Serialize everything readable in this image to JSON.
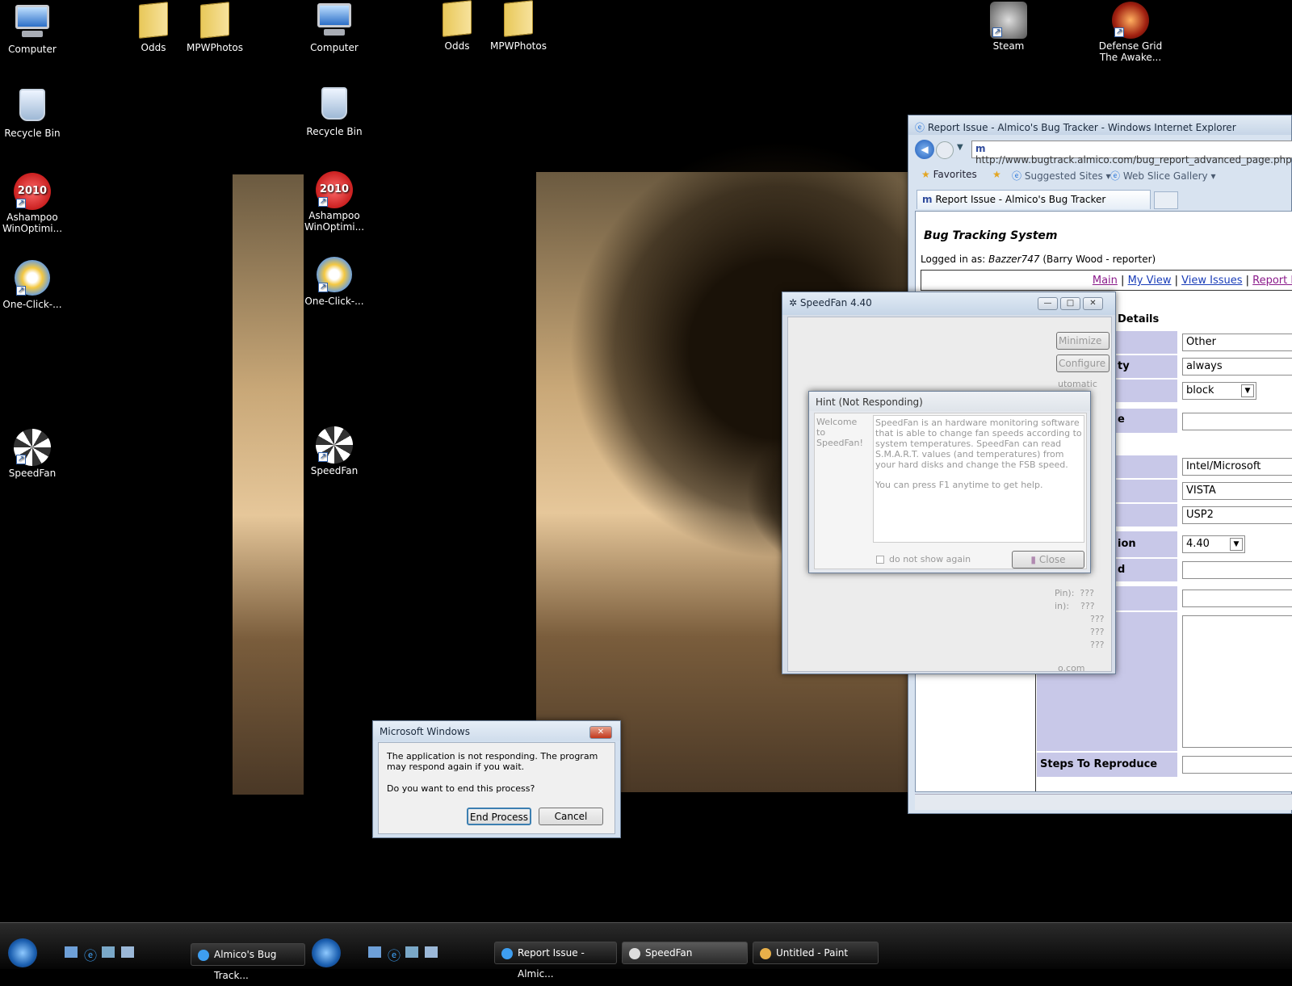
{
  "desktop": {
    "icons_left": [
      {
        "label": "Computer",
        "type": "monitor"
      },
      {
        "label": "Odds",
        "type": "folder"
      },
      {
        "label": "MPWPhotos",
        "type": "folder"
      },
      {
        "label": "Recycle Bin",
        "type": "bin"
      },
      {
        "label": "Ashampoo WinOptimi...",
        "type": "red"
      },
      {
        "label": "One-Click-...",
        "type": "gears"
      },
      {
        "label": "SpeedFan",
        "type": "fan"
      }
    ],
    "icons_mid": [
      {
        "label": "Computer"
      },
      {
        "label": "Odds"
      },
      {
        "label": "MPWPhotos"
      },
      {
        "label": "Recycle Bin"
      },
      {
        "label": "Ashampoo WinOptimi..."
      },
      {
        "label": "One-Click-..."
      },
      {
        "label": "SpeedFan"
      }
    ],
    "icons_right": [
      {
        "label": "Steam"
      },
      {
        "label": "Defense Grid The Awake..."
      }
    ],
    "ashampoo_badge": "2010"
  },
  "ie": {
    "title": "Report Issue - Almico's Bug Tracker - Windows Internet Explorer",
    "url": "http://www.bugtrack.almico.com/bug_report_advanced_page.php",
    "favorites": "Favorites",
    "suggested": "Suggested Sites ▾",
    "webslice": "Web Slice Gallery ▾",
    "tab": "Report Issue - Almico's Bug Tracker",
    "page": {
      "heading": "Bug Tracking System",
      "logged_prefix": "Logged in as: ",
      "user": "Bazzer747",
      "user_detail": " (Barry Wood - reporter)",
      "nav": [
        "Main",
        "My View",
        "View Issues",
        "Report Is"
      ],
      "section": "Details",
      "labels": [
        "ty",
        "e",
        "ion",
        "d"
      ],
      "fields": [
        "Other",
        "always",
        "block",
        "",
        "Intel/Microsoft",
        "VISTA",
        "USP2",
        "4.40",
        ""
      ],
      "steps_label": "Steps To Reproduce"
    }
  },
  "speedfan": {
    "title": "SpeedFan 4.40",
    "buttons": [
      "Minimize",
      "Configure"
    ],
    "auto": "utomatic fan",
    "readings": [
      "???",
      "???",
      "???",
      "???",
      "???"
    ],
    "rlabels": [
      "Pin):",
      "in):"
    ],
    "footer": "o.com"
  },
  "hint": {
    "title": "Hint (Not Responding)",
    "welcome": "Welcome to SpeedFan!",
    "body": "SpeedFan is an hardware monitoring software that is able to change fan speeds according to system temperatures. SpeedFan can read S.M.A.R.T. values (and temperatures) from your hard disks and change the FSB speed.",
    "help": "You can press F1 anytime to get help.",
    "checkbox": "do not show again",
    "close": "Close"
  },
  "dialog": {
    "title": "Microsoft Windows",
    "message": "The application is not responding. The program may respond again if you wait.",
    "question": "Do you want to end this process?",
    "end": "End Process",
    "cancel": "Cancel"
  },
  "taskbar": {
    "items_left": [
      "Almico's Bug Track..."
    ],
    "items_right": [
      "Report Issue - Almic...",
      "SpeedFan",
      "Untitled - Paint"
    ]
  }
}
